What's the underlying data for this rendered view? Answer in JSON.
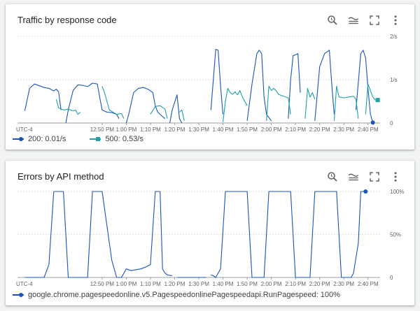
{
  "panels": [
    {
      "title": "Traffic by response code",
      "toolbar": [
        "query-history-icon",
        "legend-toggle-icon",
        "fullscreen-icon",
        "more-vert-icon"
      ],
      "legend": [
        {
          "name": "200: 0.01/s",
          "color": "#1a56b8",
          "marker": "circle"
        },
        {
          "name": "500: 0.53/s",
          "color": "#1fa1a6",
          "marker": "square"
        }
      ]
    },
    {
      "title": "Errors by API method",
      "toolbar": [
        "query-history-icon",
        "legend-toggle-icon",
        "fullscreen-icon",
        "more-vert-icon"
      ],
      "legend": [
        {
          "name": "google.chrome.pagespeedonline.v5.PagespeedonlinePagespeedapi.RunPagespeed: 100%",
          "color": "#1a56b8",
          "marker": "circle"
        }
      ]
    }
  ],
  "chart_data": [
    {
      "type": "line",
      "title": "Traffic by response code",
      "x_unit": "minutes after 12:30 PM",
      "xlim": [
        -15,
        135
      ],
      "ylim": [
        0,
        2
      ],
      "y_ticks": [
        "0",
        "1/s",
        "2/s"
      ],
      "x_ticks": [
        "UTC-4",
        "12:50 PM",
        "1:00 PM",
        "1:10 PM",
        "1:20 PM",
        "1:30 PM",
        "1:40 PM",
        "1:50 PM",
        "2:00 PM",
        "2:10 PM",
        "2:20 PM",
        "2:30 PM",
        "2:40 PM"
      ],
      "grid": true,
      "series": [
        {
          "name": "200: 0.01/s",
          "color": "#1a56b8",
          "points": [
            [
              -12,
              0.28
            ],
            [
              -10,
              0.8
            ],
            [
              -8,
              0.9
            ],
            [
              -6,
              0.86
            ],
            [
              -4,
              0.82
            ],
            [
              -2,
              0.8
            ],
            [
              0,
              0.74
            ],
            [
              1,
              0.78
            ],
            [
              2,
              0.72
            ],
            [
              3,
              0.3
            ],
            null,
            [
              5,
              0
            ],
            [
              6,
              0.3
            ],
            [
              8,
              0.75
            ],
            [
              10,
              0.88
            ],
            [
              12,
              0.87
            ],
            [
              14,
              0.84
            ],
            [
              16,
              0.92
            ],
            [
              18,
              0.9
            ],
            [
              19,
              0.6
            ],
            [
              20,
              0.3
            ],
            [
              22,
              0.25
            ],
            [
              24,
              0.24
            ],
            [
              26,
              0.2
            ],
            [
              27,
              0.1
            ],
            null,
            [
              30,
              0
            ],
            [
              31,
              0.2
            ],
            [
              33,
              0.7
            ],
            [
              35,
              0.8
            ],
            [
              37,
              0.82
            ],
            [
              39,
              0.78
            ],
            [
              41,
              0.7
            ],
            [
              42,
              0.4
            ],
            [
              43,
              0.25
            ],
            [
              44,
              0.2
            ],
            [
              46,
              0.1
            ],
            null,
            [
              48,
              0
            ],
            [
              49,
              0.3
            ],
            [
              51,
              0.65
            ],
            [
              52,
              0.1
            ],
            [
              53,
              0
            ],
            null,
            [
              65,
              0.3
            ],
            [
              67,
              1.7
            ],
            [
              68,
              1.68
            ],
            [
              69,
              0.85
            ],
            [
              70,
              0.2
            ],
            null,
            [
              80,
              0.05
            ],
            [
              82,
              0.9
            ],
            [
              84,
              1.6
            ],
            [
              85,
              1.68
            ],
            [
              86,
              1.6
            ],
            [
              87,
              0.6
            ],
            [
              88,
              0.2
            ],
            [
              90,
              0.05
            ],
            null,
            [
              97,
              0.1
            ],
            [
              98,
              1
            ],
            [
              99,
              1.55
            ],
            [
              101,
              1.6
            ],
            [
              102,
              0.7
            ],
            null,
            [
              108,
              0.05
            ],
            [
              110,
              1.3
            ],
            [
              112,
              1.6
            ],
            [
              114,
              1.68
            ],
            [
              115,
              0.9
            ],
            [
              116,
              0.2
            ],
            null,
            [
              125,
              0.3
            ],
            [
              127,
              1.6
            ],
            [
              128,
              1.68
            ],
            [
              129,
              1.5
            ],
            [
              130,
              0.8
            ],
            [
              131,
              0.2
            ],
            [
              132,
              0.01
            ]
          ],
          "end_marker": [
            132,
            0.01
          ]
        },
        {
          "name": "500: 0.53/s",
          "color": "#1fa1a6",
          "points": [
            [
              1,
              0.55
            ],
            [
              2,
              0.35
            ],
            [
              4,
              0.3
            ],
            [
              6,
              0.32
            ],
            [
              8,
              0.28
            ],
            [
              9,
              0.3
            ],
            [
              10,
              0.2
            ],
            [
              11,
              0.25
            ],
            null,
            [
              20,
              0.85
            ],
            [
              21,
              0.7
            ],
            [
              23,
              0.3
            ],
            [
              26,
              0.2
            ],
            [
              28,
              0.22
            ],
            [
              29,
              0.1
            ],
            null,
            [
              40,
              0.2
            ],
            [
              42,
              0.38
            ],
            [
              44,
              0.4
            ],
            [
              46,
              0.32
            ],
            [
              47,
              0.1
            ],
            null,
            [
              52,
              0.25
            ],
            [
              53,
              0.3
            ],
            [
              54,
              0.05
            ],
            null,
            [
              70,
              0.02
            ],
            [
              71,
              0.5
            ],
            [
              72,
              0.8
            ],
            [
              73,
              0.7
            ],
            [
              74,
              0.66
            ],
            [
              75,
              0.72
            ],
            [
              76,
              0.65
            ],
            [
              77,
              0.75
            ],
            [
              78,
              0.6
            ],
            [
              80,
              0.4
            ],
            null,
            [
              88,
              0.05
            ],
            [
              89,
              0.85
            ],
            [
              90,
              0.75
            ],
            [
              91,
              0.8
            ],
            [
              92,
              0.74
            ],
            [
              93,
              0.66
            ],
            [
              95,
              0.62
            ],
            [
              97,
              0.58
            ],
            [
              98,
              0.2
            ],
            null,
            [
              104,
              0.1
            ],
            [
              105,
              0.8
            ],
            [
              106,
              0.6
            ],
            [
              107,
              0.7
            ],
            [
              108,
              0.55
            ],
            null,
            [
              116,
              0.05
            ],
            [
              117,
              0.85
            ],
            [
              118,
              0.6
            ],
            [
              120,
              0.58
            ],
            [
              122,
              0.6
            ],
            [
              124,
              0.62
            ],
            [
              125,
              0.55
            ],
            [
              126,
              0.1
            ],
            null,
            [
              129,
              0.2
            ],
            [
              130,
              0.9
            ],
            [
              131,
              0.75
            ],
            [
              132,
              0.6
            ],
            [
              133,
              0.53
            ]
          ],
          "end_marker": [
            134,
            0.53
          ]
        }
      ]
    },
    {
      "type": "line",
      "title": "Errors by API method",
      "x_unit": "minutes after 12:30 PM",
      "xlim": [
        -15,
        135
      ],
      "ylim": [
        0,
        100
      ],
      "y_ticks": [
        "0",
        "50%",
        "100%"
      ],
      "x_ticks": [
        "UTC-4",
        "12:50 PM",
        "1:00 PM",
        "1:10 PM",
        "1:20 PM",
        "1:30 PM",
        "1:40 PM",
        "1:50 PM",
        "2:00 PM",
        "2:10 PM",
        "2:20 PM",
        "2:30 PM",
        "2:40 PM"
      ],
      "grid": true,
      "series": [
        {
          "name": "google.chrome.pagespeedonline.v5.PagespeedonlinePagespeedapi.RunPagespeed: 100%",
          "color": "#1a56b8",
          "points": [
            [
              -12,
              0
            ],
            [
              -4,
              0
            ],
            [
              -2,
              15
            ],
            [
              0,
              100
            ],
            [
              4,
              100
            ],
            [
              6,
              0
            ],
            [
              14,
              0
            ],
            [
              16,
              100
            ],
            [
              20,
              100
            ],
            [
              22,
              60
            ],
            [
              24,
              20
            ],
            [
              26,
              0
            ],
            [
              28,
              0
            ],
            [
              30,
              10
            ],
            [
              32,
              8
            ],
            [
              36,
              10
            ],
            [
              38,
              12
            ],
            [
              40,
              15
            ],
            [
              42,
              100
            ],
            [
              44,
              100
            ],
            [
              45,
              10
            ],
            [
              46,
              5
            ],
            [
              47,
              3
            ],
            [
              49,
              2
            ],
            null,
            [
              51,
              0
            ],
            [
              53,
              0
            ],
            [
              55,
              0
            ],
            [
              57,
              0
            ],
            [
              59,
              0
            ],
            [
              61,
              0
            ],
            [
              63,
              0
            ],
            null,
            [
              65,
              3
            ],
            [
              66,
              2
            ],
            [
              67,
              0
            ],
            [
              69,
              10
            ],
            [
              71,
              100
            ],
            [
              80,
              100
            ],
            [
              82,
              0
            ],
            [
              87,
              0
            ],
            [
              89,
              100
            ],
            [
              98,
              100
            ],
            [
              100,
              0
            ],
            [
              106,
              0
            ],
            [
              108,
              100
            ],
            [
              117,
              100
            ],
            [
              119,
              0
            ],
            [
              123,
              0
            ],
            [
              124,
              5
            ],
            [
              126,
              40
            ],
            [
              127,
              100
            ],
            [
              128,
              100
            ],
            [
              129,
              100
            ]
          ],
          "end_marker": [
            129,
            100
          ]
        }
      ]
    }
  ]
}
